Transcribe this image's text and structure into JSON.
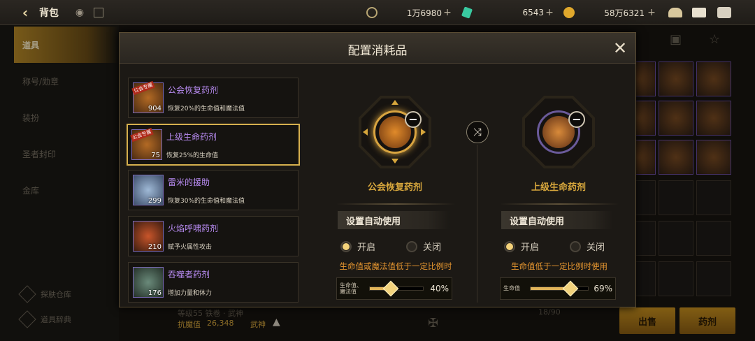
{
  "topbar": {
    "title": "背包",
    "currency1": {
      "value": "1万6980",
      "icon": "moon-coin-icon"
    },
    "currency2": {
      "value": "6543",
      "icon": "green-gem-icon"
    },
    "currency3": {
      "value": "58万6321",
      "icon": "gold-coin-icon"
    },
    "plus": "+",
    "back_icon": "‹",
    "eye_icon": "◉"
  },
  "sidebar": {
    "items": [
      "道具",
      "称号/勋章",
      "装扮",
      "圣者封印",
      "金库"
    ],
    "bottom": [
      "探肤仓库",
      "道具辞典"
    ]
  },
  "background": {
    "level_text": "等级55 铁卷 · 武神",
    "power_label": "抗魔值",
    "power_value": "26,348",
    "job": "武神",
    "capacity": "18/90",
    "sell_btn": "出售",
    "potion_btn": "药剂"
  },
  "modal": {
    "title": "配置消耗品",
    "close": "✕",
    "items": [
      {
        "name": "公会恢复药剂",
        "desc": "恢复20%的生命值和魔法值",
        "count": "904",
        "badge": "公会专属"
      },
      {
        "name": "上级生命药剂",
        "desc": "恢复25%的生命值",
        "count": "75",
        "badge": "公会专属"
      },
      {
        "name": "雷米的援助",
        "desc": "恢复30%的生命值和魔法值",
        "count": "299",
        "badge": ""
      },
      {
        "name": "火焰呼啸药剂",
        "desc": "赋予火属性攻击",
        "count": "210",
        "badge": ""
      },
      {
        "name": "吞噬者药剂",
        "desc": "增加力量和体力",
        "count": "176",
        "badge": ""
      }
    ],
    "slot_left": {
      "name": "公会恢复药剂",
      "section_title": "设置自动使用",
      "on_label": "开启",
      "off_label": "关闭",
      "selected": "on",
      "condition": "生命值或魔法值低于一定比例时",
      "slider_label_1": "生命值、",
      "slider_label_2": "魔法值",
      "slider_value": "40%",
      "slider_fraction": 0.4
    },
    "slot_right": {
      "name": "上级生命药剂",
      "section_title": "设置自动使用",
      "on_label": "开启",
      "off_label": "关闭",
      "selected": "on",
      "condition": "生命值低于一定比例时使用",
      "slider_label_1": "生命值",
      "slider_label_2": "",
      "slider_value": "69%",
      "slider_fraction": 0.69
    },
    "swap_icon": "⤨",
    "minus": "−"
  },
  "colors": {
    "accent_gold": "#d6a63c",
    "item_name_purple": "#b98cf3",
    "condition_orange": "#e69630"
  }
}
